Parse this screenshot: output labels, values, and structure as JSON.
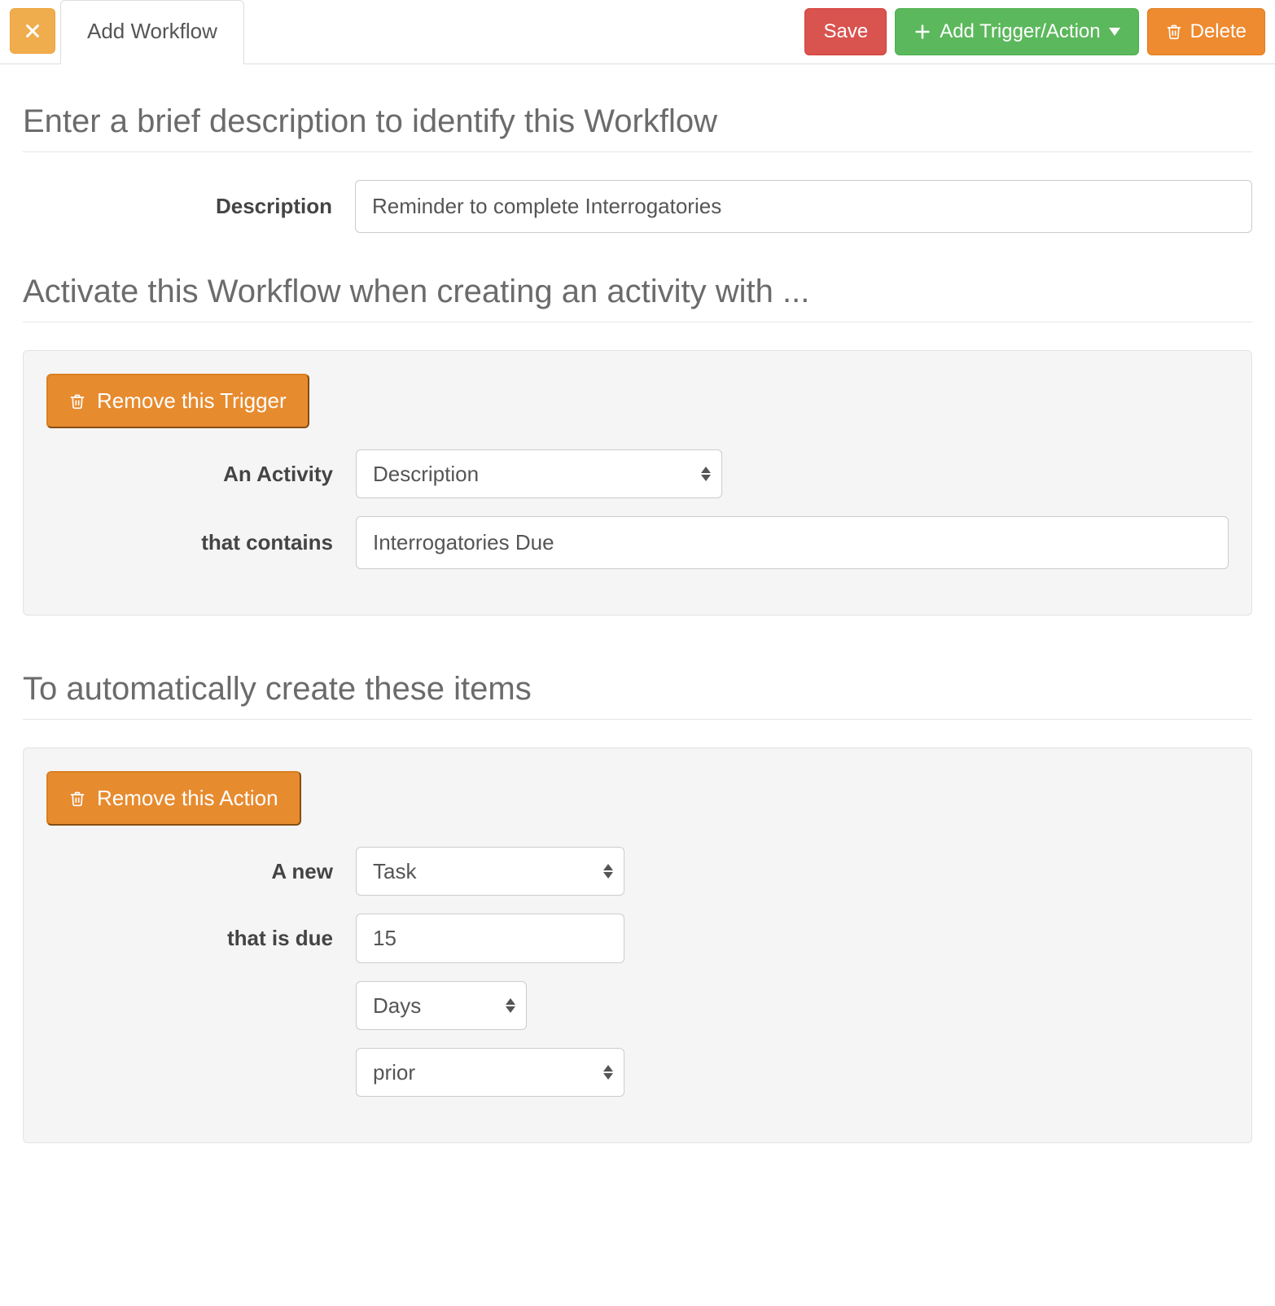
{
  "tab": {
    "label": "Add Workflow"
  },
  "toolbar": {
    "save": "Save",
    "add_trigger_action": "Add Trigger/Action",
    "delete": "Delete"
  },
  "sections": {
    "description_heading": "Enter a brief description to identify this Workflow",
    "activate_heading": "Activate this Workflow when creating an activity with ...",
    "create_heading": "To automatically create these items"
  },
  "description": {
    "label": "Description",
    "value": "Reminder to complete Interrogatories"
  },
  "trigger": {
    "remove_label": "Remove this Trigger",
    "activity_label": "An Activity",
    "activity_value": "Description",
    "contains_label": "that contains",
    "contains_value": "Interrogatories Due"
  },
  "action": {
    "remove_label": "Remove this Action",
    "new_label": "A new",
    "new_value": "Task",
    "due_label": "that is due",
    "due_value": "15",
    "unit_value": "Days",
    "relative_value": "prior"
  }
}
